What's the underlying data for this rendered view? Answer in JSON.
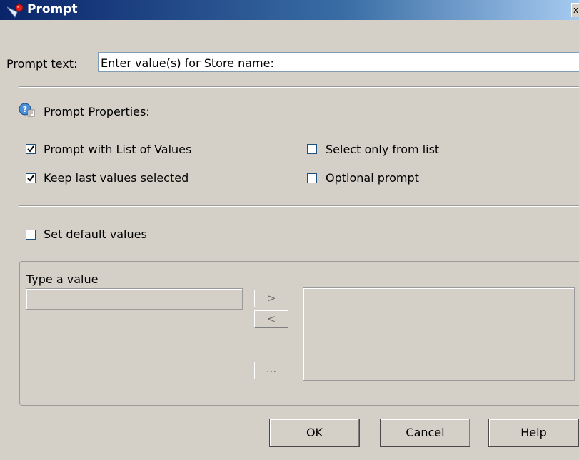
{
  "window": {
    "title": "Prompt",
    "close_glyph": "x"
  },
  "prompt_text": {
    "label": "Prompt text:",
    "value": "Enter value(s) for Store name:"
  },
  "properties": {
    "heading": "Prompt Properties:",
    "icon": "prompt-properties-icon",
    "options": [
      {
        "label": "Prompt with List of Values",
        "checked": true
      },
      {
        "label": "Keep last values selected",
        "checked": true
      },
      {
        "label": "Select only from list",
        "checked": false
      },
      {
        "label": "Optional prompt",
        "checked": false
      }
    ]
  },
  "defaults": {
    "label": "Set default values",
    "checked": false
  },
  "value_group": {
    "label": "Type a value",
    "input_value": "",
    "add_label": ">",
    "remove_label": "<",
    "browse_label": "..."
  },
  "buttons": {
    "ok": "OK",
    "cancel": "Cancel",
    "help": "Help"
  },
  "colors": {
    "titlebar_start": "#0a246a",
    "dialog_bg": "#d4d0c8",
    "checkbox_border": "#1c5180"
  }
}
